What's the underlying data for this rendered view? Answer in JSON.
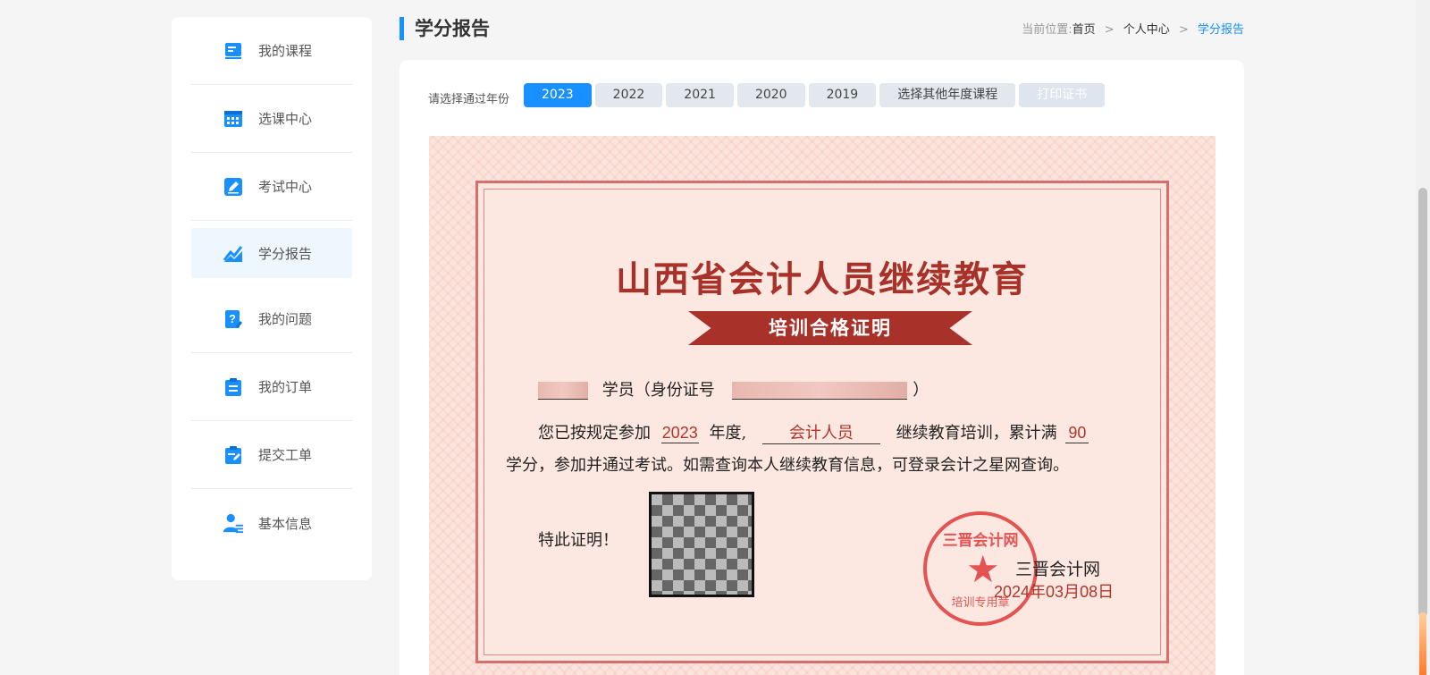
{
  "sidebar": {
    "items": [
      {
        "label": "我的课程",
        "icon": "book-icon"
      },
      {
        "label": "选课中心",
        "icon": "calendar-grid-icon"
      },
      {
        "label": "考试中心",
        "icon": "pen-edit-icon"
      },
      {
        "label": "学分报告",
        "icon": "chart-trend-icon"
      },
      {
        "label": "我的问题",
        "icon": "question-icon"
      },
      {
        "label": "我的订单",
        "icon": "clipboard-icon"
      },
      {
        "label": "提交工单",
        "icon": "ticket-edit-icon"
      },
      {
        "label": "基本信息",
        "icon": "user-info-icon"
      }
    ],
    "active_index": 3
  },
  "header": {
    "title": "学分报告",
    "breadcrumb_prefix": "当前位置:",
    "breadcrumb": [
      "首页",
      "个人中心",
      "学分报告"
    ]
  },
  "filter": {
    "label": "请选择通过年份",
    "years": [
      "2023",
      "2022",
      "2021",
      "2020",
      "2019"
    ],
    "other_years": "选择其他年度课程",
    "print": "打印证书"
  },
  "certificate": {
    "title": "山西省会计人员继续教育",
    "subtitle": "培训合格证明",
    "student_label": "学员（身份证号",
    "id_close": "）",
    "line2_prefix": "您已按规定参加",
    "year": "2023",
    "year_suffix": "年度,",
    "category": "会计人员",
    "line2_mid": "继续教育培训，累计满",
    "credits": "90",
    "line3": "学分，参加并通过考试。如需查询本人继续教育信息，可登录会计之星网查询。",
    "certify": "特此证明！",
    "seal_top": "三晋会计网",
    "seal_bottom": "培训专用章",
    "issuer": "三晋会计网",
    "date": "2024年03月08日"
  },
  "colors": {
    "accent": "#1890ff",
    "cert_red": "#a8322a",
    "seal_red": "#e03a3a"
  }
}
